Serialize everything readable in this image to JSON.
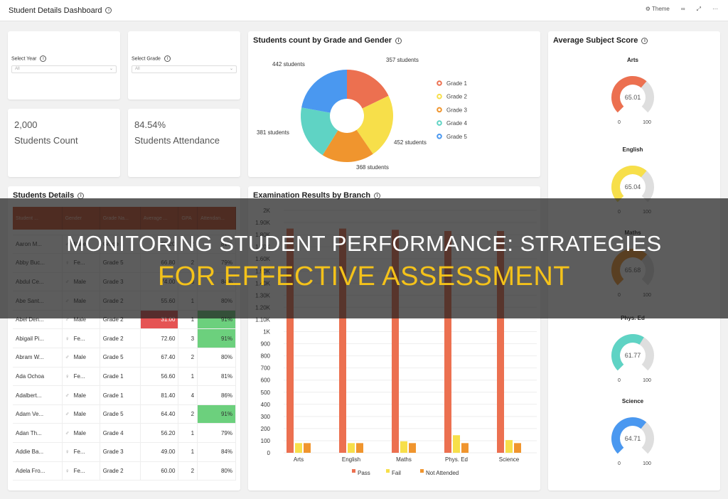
{
  "header": {
    "title": "Student Details Dashboard",
    "theme_label": "Theme",
    "buttons": [
      "share-icon",
      "expand-icon",
      "more-icon"
    ]
  },
  "filters": {
    "year": {
      "label": "Select Year",
      "value": "All"
    },
    "grade": {
      "label": "Select Grade",
      "value": "All"
    }
  },
  "stats": [
    {
      "value": "2,000",
      "label": "Students Count"
    },
    {
      "value": "84.54%",
      "label": "Students Attendance"
    }
  ],
  "donut": {
    "title": "Students count by Grade and Gender"
  },
  "table": {
    "title": "Students Details",
    "columns": [
      "Student ...",
      "Gender",
      "Grade Na...",
      "Average ...",
      "GPA",
      "Attendan..."
    ],
    "rows": [
      [
        "Aaron M...",
        "Male",
        "Grade 1",
        "68.20",
        "2",
        "81%"
      ],
      [
        "Abby Buc...",
        "Fe...",
        "Grade 5",
        "66.80",
        "2",
        "79%"
      ],
      [
        "Abdul Ce...",
        "Male",
        "Grade 3",
        "74.00",
        "3",
        "84%"
      ],
      [
        "Abe Sant...",
        "Male",
        "Grade 2",
        "55.60",
        "1",
        "80%"
      ],
      [
        "Abel Den...",
        "Male",
        "Grade 2",
        "31.00",
        "1",
        "91%"
      ],
      [
        "Abigail Pi...",
        "Fe...",
        "Grade 2",
        "72.60",
        "3",
        "91%"
      ],
      [
        "Abram W...",
        "Male",
        "Grade 5",
        "67.40",
        "2",
        "80%"
      ],
      [
        "Ada Ochoa",
        "Fe...",
        "Grade 1",
        "56.60",
        "1",
        "81%"
      ],
      [
        "Adalbert...",
        "Male",
        "Grade 1",
        "81.40",
        "4",
        "86%"
      ],
      [
        "Adam Ve...",
        "Male",
        "Grade 5",
        "64.40",
        "2",
        "91%"
      ],
      [
        "Adan Th...",
        "Male",
        "Grade 4",
        "56.20",
        "1",
        "79%"
      ],
      [
        "Addie Ba...",
        "Fe...",
        "Grade 3",
        "49.00",
        "1",
        "84%"
      ],
      [
        "Adela Fro...",
        "Fe...",
        "Grade 2",
        "60.00",
        "2",
        "80%"
      ]
    ],
    "highlight_colors": {
      "low": "#e55353",
      "high": "#6cd07d"
    }
  },
  "exam": {
    "title": "Examination Results by Branch"
  },
  "scores": {
    "title": "Average Subject Score",
    "min_label": "0",
    "max_label": "100"
  },
  "banner": {
    "line1": "MONITORING STUDENT PERFORMANCE: STRATEGIES",
    "line2": "FOR EFFECTIVE ASSESSMENT",
    "line2_color": "#f4c21a"
  },
  "chart_data": [
    {
      "type": "pie",
      "title": "Students count by Grade and Gender",
      "donut": true,
      "categories": [
        "Grade 1",
        "Grade 2",
        "Grade 3",
        "Grade 4",
        "Grade 5"
      ],
      "values": [
        357,
        452,
        368,
        381,
        442
      ],
      "labels": [
        "357 students",
        "452 students",
        "368 students",
        "381 students",
        "442 students"
      ],
      "colors": [
        "#ec7050",
        "#f7df4a",
        "#f0952e",
        "#5fd3c4",
        "#4a98f0"
      ],
      "legend": "right"
    },
    {
      "type": "bar",
      "title": "Examination Results by Branch",
      "categories": [
        "Arts",
        "English",
        "Maths",
        "Phys. Ed",
        "Science"
      ],
      "series": [
        {
          "name": "Pass",
          "values": [
            1850,
            1850,
            1840,
            1830,
            1830
          ],
          "color": "#ec7050"
        },
        {
          "name": "Fail",
          "values": [
            80,
            80,
            95,
            145,
            105
          ],
          "color": "#f7df4a"
        },
        {
          "name": "Not Attended",
          "values": [
            80,
            80,
            80,
            80,
            80
          ],
          "color": "#f0952e"
        }
      ],
      "yticks": [
        "0",
        "100",
        "200",
        "300",
        "400",
        "500",
        "600",
        "700",
        "800",
        "900",
        "1K",
        "1.10K",
        "1.20K",
        "1.30K",
        "1.40K",
        "1.50K",
        "1.60K",
        "1.70K",
        "1.80K",
        "1.90K",
        "2K"
      ],
      "ylim": [
        0,
        2000
      ],
      "grid": true,
      "legend": "bottom"
    },
    {
      "type": "gauge",
      "title": "Average Subject Score",
      "categories": [
        "Arts",
        "English",
        "Maths",
        "Phys. Ed",
        "Science"
      ],
      "values": [
        65.01,
        65.04,
        65.68,
        61.77,
        64.71
      ],
      "labels": [
        "65.01",
        "65.04",
        "65.68",
        "61.77",
        "64.71"
      ],
      "range": [
        0,
        100
      ],
      "colors": [
        "#ec7050",
        "#f7df4a",
        "#f0952e",
        "#5fd3c4",
        "#4a98f0"
      ]
    }
  ]
}
